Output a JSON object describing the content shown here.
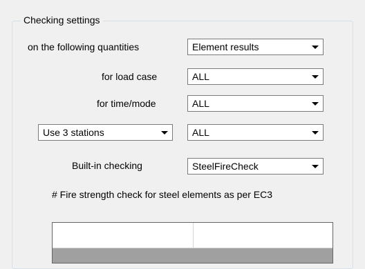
{
  "group": {
    "title": "Checking settings"
  },
  "rows": [
    {
      "label": "on  the following quantities",
      "value": "Element results"
    },
    {
      "label": "for load case",
      "value": "ALL"
    },
    {
      "label": "for time/mode",
      "value": "ALL"
    },
    {
      "left_combo": "Use 3 stations",
      "value": "ALL"
    },
    {
      "label": "Built-in checking",
      "value": "SteelFireCheck"
    }
  ],
  "description": "# Fire strength check for steel elements as per EC3",
  "table": {
    "columns": [
      "",
      ""
    ]
  },
  "icons": {
    "dropdown": "chevron-down-icon"
  }
}
